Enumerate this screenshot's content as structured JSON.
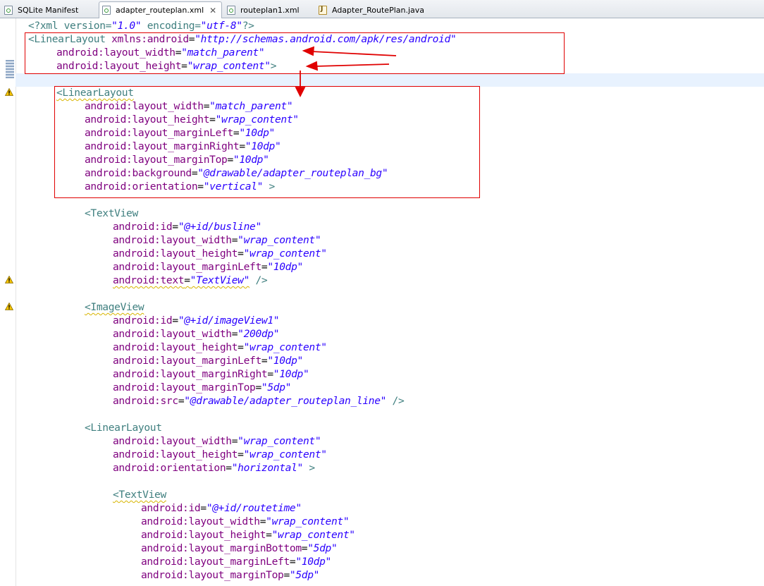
{
  "tabs": [
    {
      "label": "SQLite Manifest",
      "icon": "xml-file-icon",
      "active": false
    },
    {
      "label": "adapter_routeplan.xml",
      "icon": "xml-file-icon",
      "active": true,
      "close": "✕"
    },
    {
      "label": "routeplan1.xml",
      "icon": "xml-file-icon",
      "active": false
    },
    {
      "label": "Adapter_RoutePlan.java",
      "icon": "java-file-icon",
      "active": false
    }
  ],
  "code": {
    "l0": {
      "p1": "<?xml version=",
      "v1": "\"1.0\"",
      "p2": " encoding=",
      "v2": "\"utf-8\"",
      "p3": "?>"
    },
    "l1": {
      "tag": "<LinearLayout",
      "attr": " xmlns:android",
      "eq": "=",
      "val": "\"http://schemas.android.com/apk/res/android\""
    },
    "l2": {
      "attr": "android:layout_width",
      "eq": "=",
      "val": "\"match_parent\""
    },
    "l3": {
      "attr": "android:layout_height",
      "eq": "=",
      "val": "\"wrap_content\"",
      "end": ">"
    },
    "l5": {
      "tag": "<LinearLayout"
    },
    "l6": {
      "attr": "android:layout_width",
      "eq": "=",
      "val": "\"match_parent\""
    },
    "l7": {
      "attr": "android:layout_height",
      "eq": "=",
      "val": "\"wrap_content\""
    },
    "l8": {
      "attr": "android:layout_marginLeft",
      "eq": "=",
      "val": "\"10dp\""
    },
    "l9": {
      "attr": "android:layout_marginRight",
      "eq": "=",
      "val": "\"10dp\""
    },
    "l10": {
      "attr": "android:layout_marginTop",
      "eq": "=",
      "val": "\"10dp\""
    },
    "l11": {
      "attr": "android:background",
      "eq": "=",
      "val": "\"@drawable/adapter_routeplan_bg\""
    },
    "l12": {
      "attr": "android:orientation",
      "eq": "=",
      "val": "\"vertical\"",
      "end": " >"
    },
    "l14": {
      "tag": "<TextView"
    },
    "l15": {
      "attr": "android:id",
      "eq": "=",
      "val": "\"@+id/busline\""
    },
    "l16": {
      "attr": "android:layout_width",
      "eq": "=",
      "val": "\"wrap_content\""
    },
    "l17": {
      "attr": "android:layout_height",
      "eq": "=",
      "val": "\"wrap_content\""
    },
    "l18": {
      "attr": "android:layout_marginLeft",
      "eq": "=",
      "val": "\"10dp\""
    },
    "l19": {
      "attr": "android:text",
      "eq": "=",
      "val": "\"TextView\"",
      "end": " />"
    },
    "l21": {
      "tag": "<ImageView"
    },
    "l22": {
      "attr": "android:id",
      "eq": "=",
      "val": "\"@+id/imageView1\""
    },
    "l23": {
      "attr": "android:layout_width",
      "eq": "=",
      "val": "\"200dp\""
    },
    "l24": {
      "attr": "android:layout_height",
      "eq": "=",
      "val": "\"wrap_content\""
    },
    "l25": {
      "attr": "android:layout_marginLeft",
      "eq": "=",
      "val": "\"10dp\""
    },
    "l26": {
      "attr": "android:layout_marginRight",
      "eq": "=",
      "val": "\"10dp\""
    },
    "l27": {
      "attr": "android:layout_marginTop",
      "eq": "=",
      "val": "\"5dp\""
    },
    "l28": {
      "attr": "android:src",
      "eq": "=",
      "val": "\"@drawable/adapter_routeplan_line\"",
      "end": " />"
    },
    "l30": {
      "tag": "<LinearLayout"
    },
    "l31": {
      "attr": "android:layout_width",
      "eq": "=",
      "val": "\"wrap_content\""
    },
    "l32": {
      "attr": "android:layout_height",
      "eq": "=",
      "val": "\"wrap_content\""
    },
    "l33": {
      "attr": "android:orientation",
      "eq": "=",
      "val": "\"horizontal\"",
      "end": " >"
    },
    "l35": {
      "tag": "<TextView"
    },
    "l36": {
      "attr": "android:id",
      "eq": "=",
      "val": "\"@+id/routetime\""
    },
    "l37": {
      "attr": "android:layout_width",
      "eq": "=",
      "val": "\"wrap_content\""
    },
    "l38": {
      "attr": "android:layout_height",
      "eq": "=",
      "val": "\"wrap_content\""
    },
    "l39": {
      "attr": "android:layout_marginBottom",
      "eq": "=",
      "val": "\"5dp\""
    },
    "l40": {
      "attr": "android:layout_marginLeft",
      "eq": "=",
      "val": "\"10dp\""
    },
    "l41": {
      "attr": "android:layout_marginTop",
      "eq": "=",
      "val": "\"5dp\""
    }
  },
  "colors": {
    "tag": "#3f7f7f",
    "attribute": "#7f007f",
    "value": "#2a00ff",
    "annotation": "#e00000"
  },
  "gutter_icons": [
    "warning-icon",
    "warning-icon",
    "warning-icon"
  ]
}
